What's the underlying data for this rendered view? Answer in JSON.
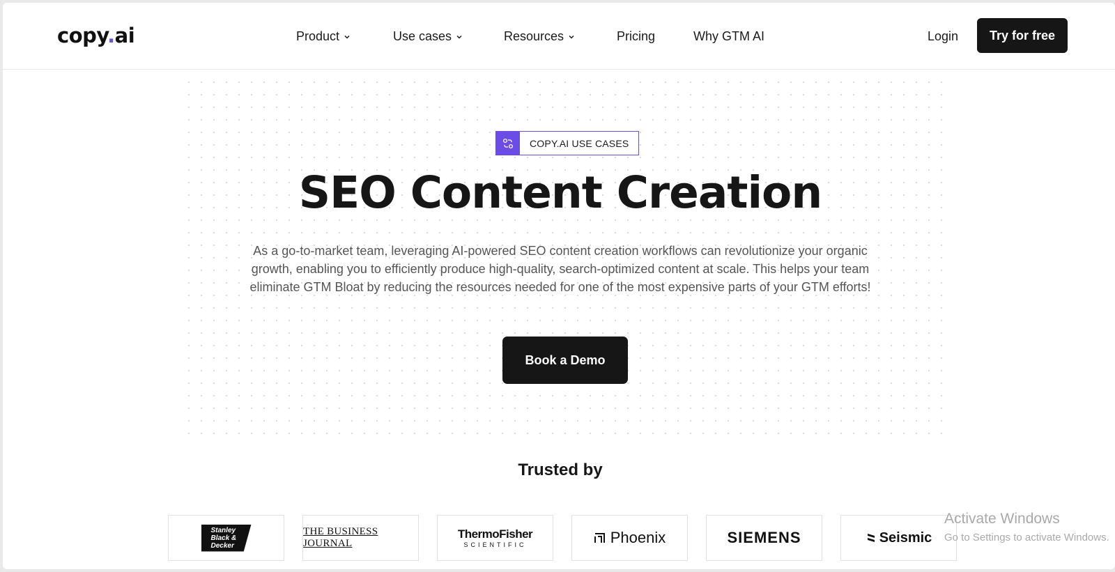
{
  "header": {
    "logo": {
      "prefix": "copy",
      "dot": ".",
      "suffix": "ai"
    },
    "nav": [
      {
        "label": "Product",
        "has_dropdown": true
      },
      {
        "label": "Use cases",
        "has_dropdown": true
      },
      {
        "label": "Resources",
        "has_dropdown": true
      },
      {
        "label": "Pricing",
        "has_dropdown": false
      },
      {
        "label": "Why GTM AI",
        "has_dropdown": false
      }
    ],
    "login_label": "Login",
    "cta_label": "Try for free"
  },
  "hero": {
    "badge_label": "COPY.AI USE CASES",
    "badge_icon": "workflow-icon",
    "title": "SEO Content Creation",
    "description_lines": [
      "As a go-to-market team, leveraging AI-powered SEO content creation workflows can revolutionize your organic",
      "growth, enabling you to efficiently produce high-quality, search-optimized content at scale. This helps your team",
      "eliminate GTM Bloat by reducing the resources needed for one of the most expensive parts of your GTM efforts!"
    ],
    "cta_label": "Book a Demo"
  },
  "trusted": {
    "heading": "Trusted by",
    "logos": {
      "stanley": [
        "Stanley",
        "Black &",
        "Decker"
      ],
      "business_journal": "THE BUSINESS JOURNAL",
      "thermo": {
        "line1": "ThermoFisher",
        "line2": "SCIENTIFIC"
      },
      "phoenix": "Phoenix",
      "siemens": "SIEMENS",
      "seismic": "Seismic"
    }
  },
  "watermark": {
    "line1": "Activate Windows",
    "line2": "Go to Settings to activate Windows."
  },
  "colors": {
    "accent": "#6b4ce6",
    "dark": "#161616",
    "text_muted": "#555555"
  }
}
